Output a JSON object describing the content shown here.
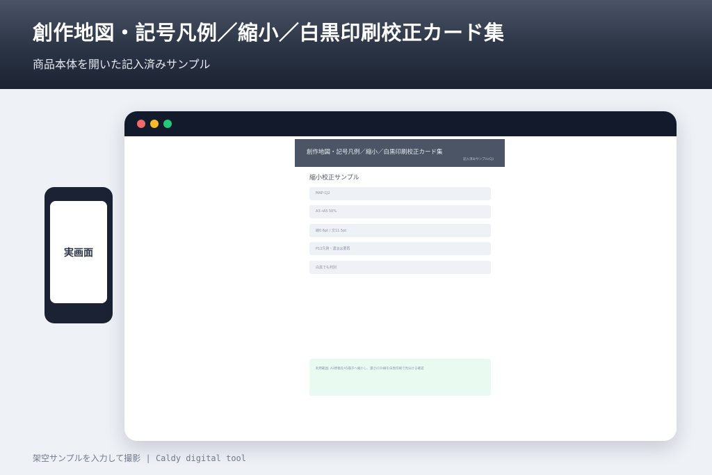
{
  "hero": {
    "title": "創作地図・記号凡例／縮小／白黒印刷校正カード集",
    "subtitle": "商品本体を開いた記入済みサンプル"
  },
  "phone": {
    "screen_label": "実画面"
  },
  "browser": {
    "controls": [
      "close",
      "minimize",
      "maximize"
    ],
    "page": {
      "header_title": "創作地図・記号凡例／縮小／白黒印刷校正カード集",
      "header_tag": "記入済みサンプル(CJ)",
      "section_title": "縮小校正サンプル",
      "fields": [
        "MAP-CJ2",
        "A3→A5 50%",
        "線0.6pt / 文11.5pt",
        "P12凡例・濃淡は要再",
        "白黒でも判別"
      ],
      "note": "利用範囲: A3原稿をA5冊子へ縮小し、濃さ(CO)線を白黒印刷で見分ける確認"
    }
  },
  "footer": {
    "text": "架空サンプルを入力して撮影 | Caldy digital tool"
  },
  "colors": {
    "hero_bg": "#2b3445",
    "browser_bar": "#131a2c",
    "dot_red": "#ef6a6a",
    "dot_yellow": "#f6b92b",
    "dot_green": "#22c87c",
    "note_bg": "#e9fbf1"
  }
}
